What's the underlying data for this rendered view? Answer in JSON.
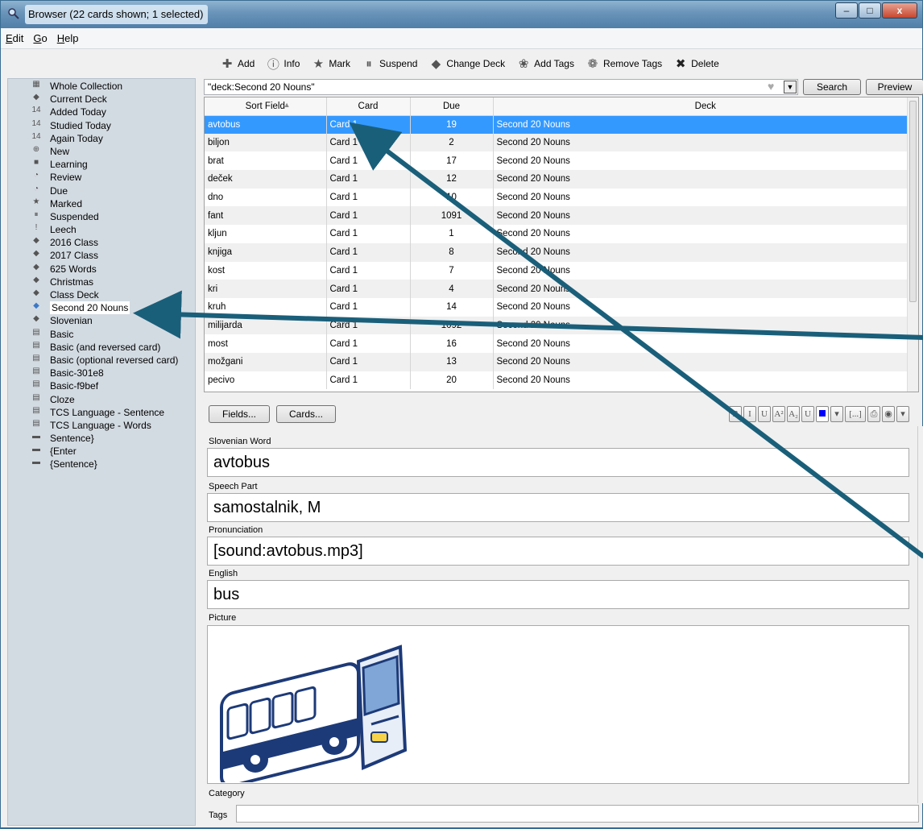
{
  "window": {
    "title": "Browser (22 cards shown; 1 selected)",
    "controls": {
      "minimize": "–",
      "maximize": "□",
      "close": "x"
    }
  },
  "menu": [
    {
      "label": "Edit",
      "key": "E",
      "rest": "dit"
    },
    {
      "label": "Go",
      "key": "G",
      "rest": "o"
    },
    {
      "label": "Help",
      "key": "H",
      "rest": "elp"
    }
  ],
  "toolbar": [
    {
      "label": "Add",
      "icon": "add-icon",
      "glyph": "✚"
    },
    {
      "label": "Info",
      "icon": "info-icon",
      "glyph": "ⓘ"
    },
    {
      "label": "Mark",
      "icon": "star-icon",
      "glyph": "★"
    },
    {
      "label": "Suspend",
      "icon": "pause-icon",
      "glyph": "⏸"
    },
    {
      "label": "Change Deck",
      "icon": "deck-icon",
      "glyph": "◆"
    },
    {
      "label": "Add Tags",
      "icon": "tag-add-icon",
      "glyph": "❀"
    },
    {
      "label": "Remove Tags",
      "icon": "tag-remove-icon",
      "glyph": "❁"
    },
    {
      "label": "Delete",
      "icon": "delete-icon",
      "glyph": "✖"
    }
  ],
  "sidebar": [
    {
      "label": "Whole Collection",
      "icon": "collection-icon",
      "glyph": "▦"
    },
    {
      "label": "Current Deck",
      "icon": "deck-icon",
      "glyph": "◆"
    },
    {
      "label": "Added Today",
      "icon": "calendar-icon",
      "glyph": "14"
    },
    {
      "label": "Studied Today",
      "icon": "calendar-icon",
      "glyph": "14"
    },
    {
      "label": "Again Today",
      "icon": "calendar-icon",
      "glyph": "14"
    },
    {
      "label": "New",
      "icon": "plus-circle-icon",
      "glyph": "⊕"
    },
    {
      "label": "Learning",
      "icon": "book-icon",
      "glyph": "■"
    },
    {
      "label": "Review",
      "icon": "clock-icon",
      "glyph": "◔"
    },
    {
      "label": "Due",
      "icon": "clock-icon",
      "glyph": "◔"
    },
    {
      "label": "Marked",
      "icon": "star-icon",
      "glyph": "★"
    },
    {
      "label": "Suspended",
      "icon": "pause-icon",
      "glyph": "⏸"
    },
    {
      "label": "Leech",
      "icon": "warning-icon",
      "glyph": "!"
    },
    {
      "label": "2016 Class",
      "icon": "deck-icon",
      "glyph": "◆"
    },
    {
      "label": "2017 Class",
      "icon": "deck-icon",
      "glyph": "◆"
    },
    {
      "label": "625 Words",
      "icon": "deck-icon",
      "glyph": "◆"
    },
    {
      "label": "Christmas",
      "icon": "deck-icon",
      "glyph": "◆"
    },
    {
      "label": "Class Deck",
      "icon": "deck-icon",
      "glyph": "◆"
    },
    {
      "label": "Second 20 Nouns",
      "icon": "deck-icon",
      "glyph": "◆",
      "selected": true
    },
    {
      "label": "Slovenian",
      "icon": "deck-icon",
      "glyph": "◆"
    },
    {
      "label": "Basic",
      "icon": "note-type-icon",
      "glyph": "▤"
    },
    {
      "label": "Basic (and reversed card)",
      "icon": "note-type-icon",
      "glyph": "▤"
    },
    {
      "label": "Basic (optional reversed card)",
      "icon": "note-type-icon",
      "glyph": "▤"
    },
    {
      "label": "Basic-301e8",
      "icon": "note-type-icon",
      "glyph": "▤"
    },
    {
      "label": "Basic-f9bef",
      "icon": "note-type-icon",
      "glyph": "▤"
    },
    {
      "label": "Cloze",
      "icon": "note-type-icon",
      "glyph": "▤"
    },
    {
      "label": "TCS Language - Sentence",
      "icon": "note-type-icon",
      "glyph": "▤"
    },
    {
      "label": "TCS Language - Words",
      "icon": "note-type-icon",
      "glyph": "▤"
    },
    {
      "label": "Sentence}",
      "icon": "tag-icon",
      "glyph": "▬"
    },
    {
      "label": "{Enter",
      "icon": "tag-icon",
      "glyph": "▬"
    },
    {
      "label": "{Sentence}",
      "icon": "tag-icon",
      "glyph": "▬"
    }
  ],
  "search": {
    "value": "\"deck:Second 20 Nouns\"",
    "search_label": "Search",
    "preview_label": "Preview"
  },
  "table": {
    "headers": [
      "Sort Field",
      "Card",
      "Due",
      "Deck"
    ],
    "rows": [
      [
        "avtobus",
        "Card 1",
        "19",
        "Second 20 Nouns"
      ],
      [
        "biljon",
        "Card 1",
        "2",
        "Second 20 Nouns"
      ],
      [
        "brat",
        "Card 1",
        "17",
        "Second 20 Nouns"
      ],
      [
        "deček",
        "Card 1",
        "12",
        "Second 20 Nouns"
      ],
      [
        "dno",
        "Card 1",
        "10",
        "Second 20 Nouns"
      ],
      [
        "fant",
        "Card 1",
        "1091",
        "Second 20 Nouns"
      ],
      [
        "kljun",
        "Card 1",
        "1",
        "Second 20 Nouns"
      ],
      [
        "knjiga",
        "Card 1",
        "8",
        "Second 20 Nouns"
      ],
      [
        "kost",
        "Card 1",
        "7",
        "Second 20 Nouns"
      ],
      [
        "kri",
        "Card 1",
        "4",
        "Second 20 Nouns"
      ],
      [
        "kruh",
        "Card 1",
        "14",
        "Second 20 Nouns"
      ],
      [
        "milijarda",
        "Card 1",
        "1092",
        "Second 20 Nouns"
      ],
      [
        "most",
        "Card 1",
        "16",
        "Second 20 Nouns"
      ],
      [
        "možgani",
        "Card 1",
        "13",
        "Second 20 Nouns"
      ],
      [
        "pecivo",
        "Card 1",
        "20",
        "Second 20 Nouns"
      ]
    ]
  },
  "editor": {
    "fields_label": "Fields...",
    "cards_label": "Cards...",
    "format_buttons": [
      "B",
      "I",
      "U",
      "A²",
      "A₂",
      "U",
      "■",
      "▾",
      "[...]",
      "⎙",
      "◉",
      "▾"
    ],
    "fields": [
      {
        "name": "Slovenian Word",
        "value": "avtobus"
      },
      {
        "name": "Speech Part",
        "value": "samostalnik, M"
      },
      {
        "name": "Pronunciation",
        "value": "[sound:avtobus.mp3]"
      },
      {
        "name": "English",
        "value": "bus"
      },
      {
        "name": "Picture",
        "value": ""
      },
      {
        "name": "Category",
        "value": ""
      }
    ],
    "tags_label": "Tags",
    "tags_value": ""
  },
  "colors": {
    "selection": "#3399ff",
    "sidebar_bg": "#d3dbe2",
    "arrow": "#1a5f7a"
  }
}
